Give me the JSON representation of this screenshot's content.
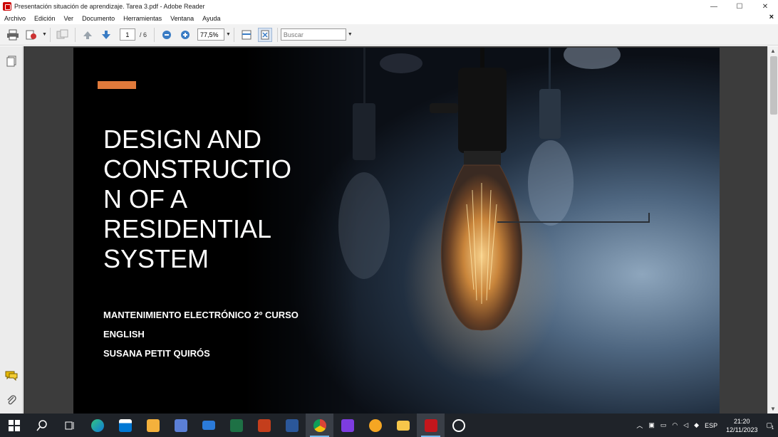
{
  "window": {
    "title": "Presentación situación de aprendizaje. Tarea 3.pdf - Adobe Reader",
    "controls": {
      "minimize": "—",
      "maximize": "☐",
      "close": "✕"
    }
  },
  "menu": {
    "items": [
      "Archivo",
      "Edición",
      "Ver",
      "Documento",
      "Herramientas",
      "Ventana",
      "Ayuda"
    ],
    "close_doc": "×"
  },
  "toolbar": {
    "page_current": "1",
    "page_total": "/ 6",
    "zoom": "77,5%",
    "search_placeholder": "Buscar"
  },
  "slide": {
    "title": "DESIGN AND\nCONSTRUCTIO\nN OF A\nRESIDENTIAL\nSYSTEM",
    "subtitle_lines": [
      "MANTENIMIENTO ELECTRÓNICO 2º CURSO",
      "ENGLISH",
      "SUSANA PETIT QUIRÓS"
    ],
    "accent_color": "#e07a3b"
  },
  "taskbar": {
    "apps": [
      "start",
      "search",
      "task-view",
      "edge",
      "store",
      "media-player",
      "notepad",
      "mail",
      "excel",
      "powerpoint",
      "word",
      "chrome",
      "onenote",
      "brave",
      "file-explorer",
      "adobe-reader",
      "screen-recorder"
    ],
    "tray": {
      "language": "ESP",
      "time": "21:20",
      "date": "12/11/2023",
      "notifications": "1"
    }
  }
}
